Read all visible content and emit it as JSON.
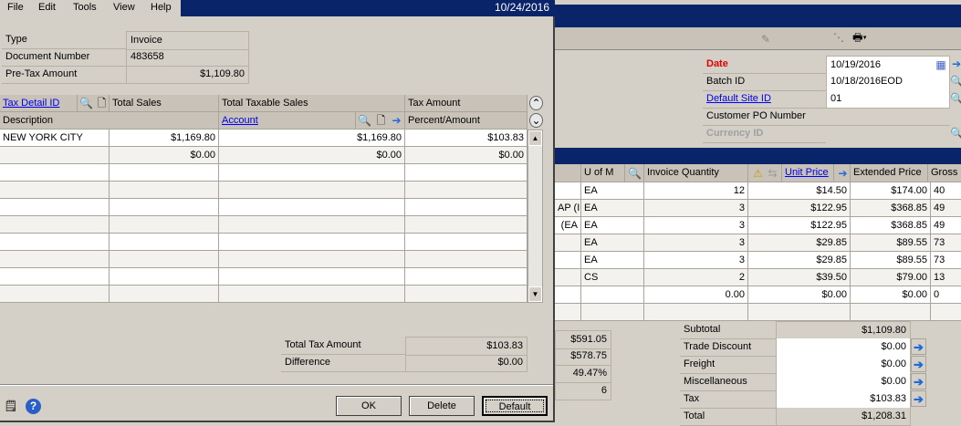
{
  "dialog": {
    "menu": [
      "File",
      "Edit",
      "Tools",
      "View",
      "Help"
    ],
    "date": "10/24/2016",
    "fields": [
      {
        "label": "Type",
        "value": "Invoice"
      },
      {
        "label": "Document Number",
        "value": "483658"
      },
      {
        "label": "Pre-Tax Amount",
        "value": "$1,109.80"
      }
    ],
    "grid_headers": {
      "tax_detail_id": "Tax Detail ID",
      "total_sales": "Total Sales",
      "total_taxable_sales": "Total Taxable Sales",
      "tax_amount": "Tax Amount",
      "description": "Description",
      "account": "Account",
      "percent_amount": "Percent/Amount"
    },
    "rows": [
      {
        "description": "NEW YORK CITY",
        "total_sales": "$1,169.80",
        "taxable": "$1,169.80",
        "tax": "$103.83"
      },
      {
        "description": "",
        "total_sales": "$0.00",
        "taxable": "$0.00",
        "tax": "$0.00"
      }
    ],
    "totals": {
      "total_tax_label": "Total Tax Amount",
      "total_tax": "$103.83",
      "difference_label": "Difference",
      "difference": "$0.00"
    },
    "buttons": {
      "ok": "OK",
      "delete": "Delete",
      "default": "Default"
    }
  },
  "main": {
    "header_fields": [
      {
        "label": "Date",
        "value": "10/19/2016"
      },
      {
        "label": "Batch ID",
        "value": "10/18/2016EOD"
      },
      {
        "label": "Default Site ID",
        "value": "01"
      },
      {
        "label": "Customer PO Number",
        "value": ""
      },
      {
        "label": "Currency ID",
        "value": ""
      }
    ],
    "grid_headers": {
      "uom": "U of M",
      "qty": "Invoice Quantity",
      "unit_price": "Unit Price",
      "ext_price": "Extended Price",
      "gross": "Gross P"
    },
    "rows": [
      {
        "item": "",
        "uom": "EA",
        "qty": "12",
        "unit": "$14.50",
        "ext": "$174.00",
        "gross": "40"
      },
      {
        "item": "AP (I",
        "uom": "EA",
        "qty": "3",
        "unit": "$122.95",
        "ext": "$368.85",
        "gross": "49"
      },
      {
        "item": "(EA",
        "uom": "EA",
        "qty": "3",
        "unit": "$122.95",
        "ext": "$368.85",
        "gross": "49"
      },
      {
        "item": "",
        "uom": "EA",
        "qty": "3",
        "unit": "$29.85",
        "ext": "$89.55",
        "gross": "73"
      },
      {
        "item": "",
        "uom": "EA",
        "qty": "3",
        "unit": "$29.85",
        "ext": "$89.55",
        "gross": "73"
      },
      {
        "item": "",
        "uom": "CS",
        "qty": "2",
        "unit": "$39.50",
        "ext": "$79.00",
        "gross": "13"
      },
      {
        "item": "",
        "uom": "",
        "qty": "0.00",
        "unit": "$0.00",
        "ext": "$0.00",
        "gross": "0"
      }
    ],
    "left_totals": [
      "$591.05",
      "$578.75",
      "49.47%",
      "6"
    ],
    "totals": [
      {
        "label": "Subtotal",
        "value": "$1,109.80"
      },
      {
        "label": "Trade Discount",
        "value": "$0.00"
      },
      {
        "label": "Freight",
        "value": "$0.00"
      },
      {
        "label": "Miscellaneous",
        "value": "$0.00"
      },
      {
        "label": "Tax",
        "value": "$103.83"
      },
      {
        "label": "Total",
        "value": "$1,208.31"
      }
    ]
  },
  "colors": {
    "title_bar": "#0a246a",
    "required_label": "#e00000",
    "link": "#0000ee"
  }
}
